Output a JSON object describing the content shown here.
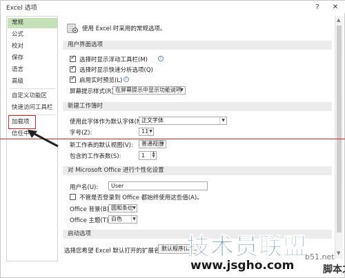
{
  "window": {
    "title": "Excel 选项",
    "help_glyph": "?",
    "close_glyph": "✕"
  },
  "sidebar": {
    "items": [
      {
        "label": "常规"
      },
      {
        "label": "公式"
      },
      {
        "label": "校对"
      },
      {
        "label": "保存"
      },
      {
        "label": "语言"
      },
      {
        "label": "高级"
      },
      {
        "label": "自定义功能区"
      },
      {
        "label": "快速访问工具栏"
      },
      {
        "label": "加载项"
      },
      {
        "label": "信任中心"
      }
    ],
    "active_index": 0
  },
  "main": {
    "intro": "使用 Excel 时采用的常规选项。",
    "ui_section": {
      "header": "用户界面选项",
      "options": [
        {
          "label": "选择时显示浮动工具栏(M)",
          "checked": true
        },
        {
          "label": "选择时显示快速分析选项(Q)",
          "checked": true
        },
        {
          "label": "启用实时预览(L)",
          "checked": true
        }
      ],
      "tooltip_style_label": "屏幕提示样式(R):",
      "tooltip_style_value": "在屏幕提示中显示功能说明"
    },
    "new_workbook_section": {
      "header": "新建工作簿时",
      "font_label": "使用此字体作为默认字体(N):",
      "font_value": "正文字体",
      "size_label": "字号(Z):",
      "size_value": "11",
      "view_label": "新工作表的默认视图(V):",
      "view_value": "普通视图",
      "sheets_label": "包含的工作表数(S):",
      "sheets_value": "1"
    },
    "personalize_section": {
      "header": "对 Microsoft Office 进行个性化设置",
      "username_label": "用户名(U):",
      "username_value": "User",
      "always_use_label": "不管是否登录到 Office 都始终使用这些值(A)。",
      "always_use_checked": false,
      "background_label": "Office 背景(B):",
      "background_value": "圆和条纹",
      "theme_label": "Office 主题(T):",
      "theme_value": "白色"
    },
    "startup_section": {
      "header": "启动选项",
      "ext_label": "选择您希望 Excel 默认打开的扩展名:",
      "ext_button": "默认程序(D)..."
    }
  },
  "watermark": {
    "main": "技术员联盟",
    "url": "www.jsgho.com",
    "extra": "b51.net",
    "extra2": "脚本之家"
  },
  "colors": {
    "active_nav": "#c5e1b8",
    "annotation": "#dd2222",
    "watermark_blue": "#0f5fb8"
  }
}
